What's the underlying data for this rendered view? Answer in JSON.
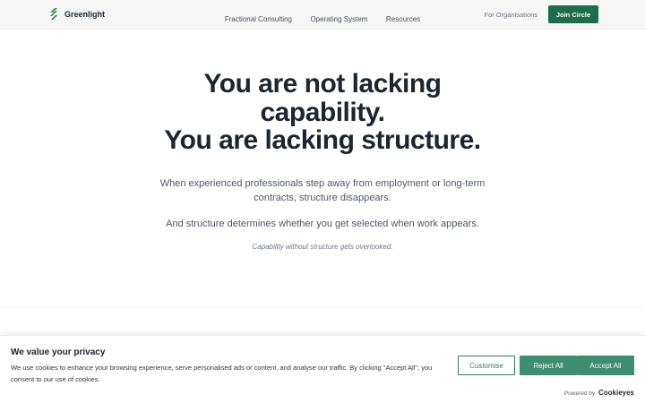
{
  "header": {
    "logo_text": "Greenlight",
    "nav": [
      "Fractional Consulting",
      "Operating System",
      "Resources"
    ],
    "for_organisations": "For Organisations",
    "join_button": "Join Circle",
    "brand_color": "#1f6b4e",
    "logo_icon": "leaf-logo-icon"
  },
  "hero": {
    "title_line1": "You are not lacking",
    "title_line2": "capability.",
    "title_line3": "You are lacking structure.",
    "paragraph1": "When experienced professionals step away from employment or long-term contracts, structure disappears.",
    "paragraph2": "And structure determines whether you get selected when work appears.",
    "note": "Capability without structure gets overlooked."
  },
  "cookie_banner": {
    "title": "We value your privacy",
    "text": "We use cookies to enhance your browsing experience, serve personalised ads or content, and analyse our traffic. By clicking \"Accept All\", you consent to our use of cookies.",
    "customise": "Customise",
    "reject_all": "Reject All",
    "accept_all": "Accept All",
    "powered_by": "Powered by",
    "powered_brand": "Cookieyes",
    "button_color": "#3f8d70"
  }
}
